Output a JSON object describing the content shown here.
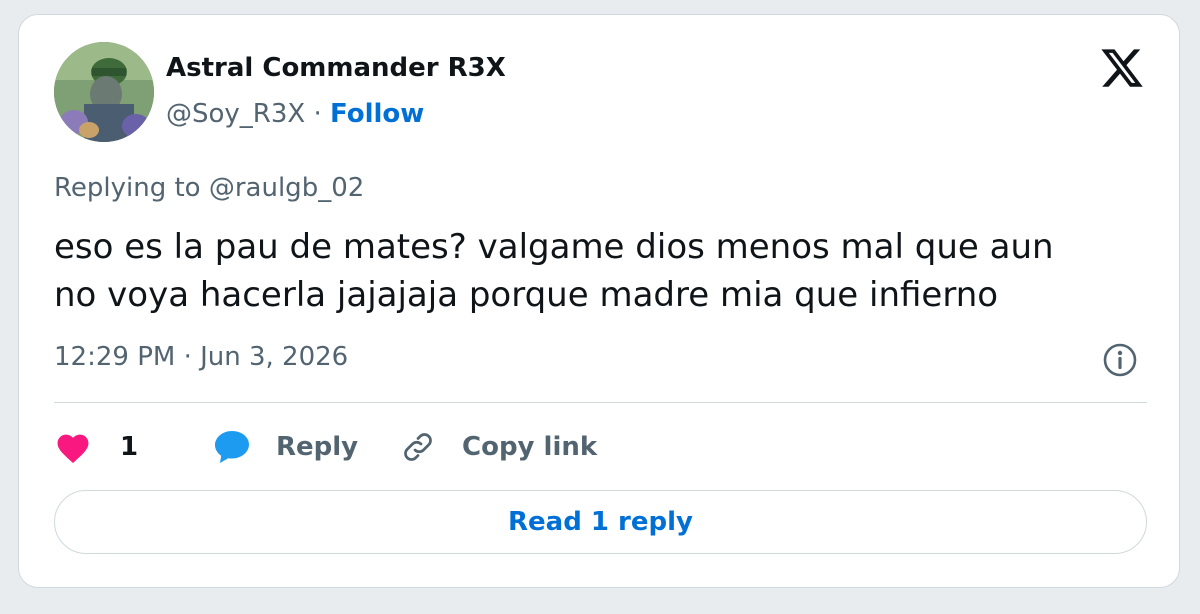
{
  "tweet": {
    "author": {
      "display_name": "Astral Commander R3X",
      "handle": "@Soy_R3X",
      "separator": "·",
      "follow_label": "Follow"
    },
    "reply_context": {
      "prefix": "Replying to",
      "mention": "@raulgb_02"
    },
    "text_lines": [
      "eso es la pau de mates? valgame dios menos mal que aun",
      "no voya hacerla jajajaja porque madre mia que infierno"
    ],
    "timestamp": "12:29 PM · Jun 3, 2026",
    "actions": {
      "like_count": "1",
      "reply_label": "Reply",
      "copy_link_label": "Copy link"
    },
    "read_replies_label": "Read 1 reply"
  },
  "icons": {
    "logo": "x-logo-icon",
    "info": "info-icon",
    "like": "heart-icon",
    "reply": "speech-bubble-icon",
    "copy_link": "link-icon"
  },
  "colors": {
    "follow": "#006fd6",
    "like": "#f91880",
    "reply_bubble": "#1d9bf0",
    "text_primary": "#0f1419",
    "text_secondary": "#536471",
    "border": "#cfd9de"
  }
}
